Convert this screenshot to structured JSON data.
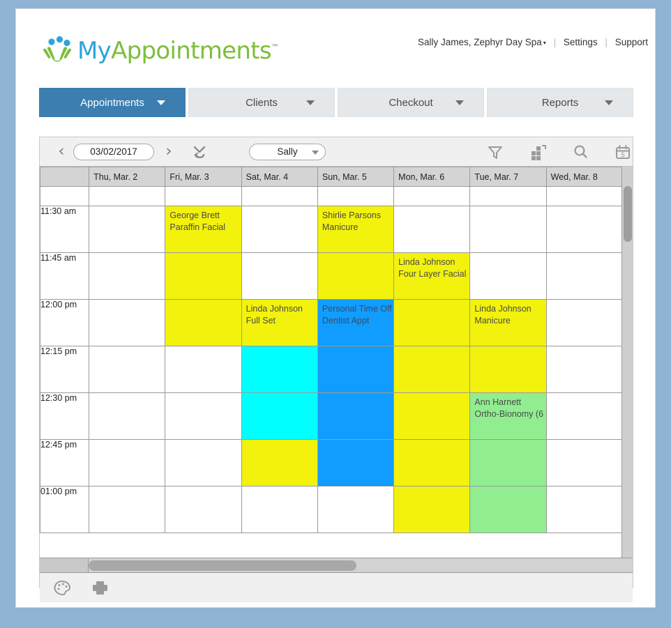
{
  "brand": {
    "name_part1": "My",
    "name_part2": "Appointments",
    "trademark": "™",
    "logo_icon": "hands-with-dots-logo",
    "color_blue": "#2EA3DC",
    "color_green": "#7DBE3B"
  },
  "account": {
    "user_and_org": "Sally James, Zephyr Day Spa",
    "caret": "▾",
    "separator": "|",
    "settings": "Settings",
    "support": "Support"
  },
  "nav": {
    "active_index": 0,
    "active_color": "#3C7EB0",
    "tabs": [
      {
        "label": "Appointments"
      },
      {
        "label": "Clients"
      },
      {
        "label": "Checkout"
      },
      {
        "label": "Reports"
      }
    ]
  },
  "toolbar": {
    "prev_arrow": "‹",
    "next_arrow": "›",
    "date": "03/02/2017",
    "collapse_icon": "collapse-rows-icon",
    "staff": {
      "value": "Sally"
    },
    "icons": [
      {
        "name": "filter-icon"
      },
      {
        "name": "grid-expand-icon"
      },
      {
        "name": "search-icon"
      },
      {
        "name": "calendar-day-icon",
        "badge": "5"
      }
    ]
  },
  "page_nav": {
    "prev": "‹",
    "next": "›"
  },
  "calendar": {
    "day_headers": [
      "Thu, Mar. 2",
      "Fri, Mar. 3",
      "Sat, Mar. 4",
      "Sun, Mar. 5",
      "Mon, Mar. 6",
      "Tue, Mar. 7",
      "Wed, Mar. 8"
    ],
    "times": [
      "11:30 am",
      "11:45 am",
      "12:00 pm",
      "12:15 pm",
      "12:30 pm",
      "12:45 pm",
      "01:00 pm"
    ],
    "colors": {
      "yellow": "#F2F20D",
      "cyan": "#00FFFF",
      "blue": "#119DFF",
      "green": "#90EE90",
      "header_gray": "#D4D4D4",
      "grid_line": "#9A9A9A"
    },
    "appointments": [
      {
        "day": 1,
        "time": 0,
        "client": "George Brett",
        "service": "Paraffin Facial",
        "color": "#F2F20D"
      },
      {
        "day": 3,
        "time": 0,
        "client": "Shirlie Parsons",
        "service": "Manicure",
        "color": "#F2F20D"
      },
      {
        "day": 1,
        "time": 1,
        "client": "",
        "service": "",
        "color": "#F2F20D"
      },
      {
        "day": 3,
        "time": 1,
        "client": "",
        "service": "",
        "color": "#F2F20D"
      },
      {
        "day": 4,
        "time": 1,
        "client": "Linda Johnson",
        "service": "Four Layer Facial",
        "color": "#F2F20D"
      },
      {
        "day": 1,
        "time": 2,
        "client": "",
        "service": "",
        "color": "#F2F20D"
      },
      {
        "day": 2,
        "time": 2,
        "client": "Linda Johnson",
        "service": "Full Set",
        "color": "#F2F20D"
      },
      {
        "day": 3,
        "time": 2,
        "client": "Personal Time Off",
        "service": "Dentist Appt",
        "color": "#119DFF"
      },
      {
        "day": 4,
        "time": 2,
        "client": "",
        "service": "",
        "color": "#F2F20D"
      },
      {
        "day": 5,
        "time": 2,
        "client": "Linda Johnson",
        "service": "Manicure",
        "color": "#F2F20D"
      },
      {
        "day": 2,
        "time": 3,
        "client": "",
        "service": "",
        "color": "#00FFFF"
      },
      {
        "day": 3,
        "time": 3,
        "client": "",
        "service": "",
        "color": "#119DFF"
      },
      {
        "day": 4,
        "time": 3,
        "client": "",
        "service": "",
        "color": "#F2F20D"
      },
      {
        "day": 5,
        "time": 3,
        "client": "",
        "service": "",
        "color": "#F2F20D"
      },
      {
        "day": 2,
        "time": 4,
        "client": "",
        "service": "",
        "color": "#00FFFF"
      },
      {
        "day": 3,
        "time": 4,
        "client": "",
        "service": "",
        "color": "#119DFF"
      },
      {
        "day": 4,
        "time": 4,
        "client": "",
        "service": "",
        "color": "#F2F20D"
      },
      {
        "day": 5,
        "time": 4,
        "client": "Ann Harnett",
        "service": "Ortho-Bionomy (6",
        "color": "#90EE90"
      },
      {
        "day": 2,
        "time": 5,
        "client": "",
        "service": "",
        "color": "#F2F20D"
      },
      {
        "day": 3,
        "time": 5,
        "client": "",
        "service": "",
        "color": "#119DFF"
      },
      {
        "day": 4,
        "time": 5,
        "client": "",
        "service": "",
        "color": "#F2F20D"
      },
      {
        "day": 5,
        "time": 5,
        "client": "",
        "service": "",
        "color": "#90EE90"
      },
      {
        "day": 4,
        "time": 6,
        "client": "",
        "service": "",
        "color": "#F2F20D"
      },
      {
        "day": 5,
        "time": 6,
        "client": "",
        "service": "",
        "color": "#90EE90"
      }
    ]
  },
  "footer": {
    "icons": [
      {
        "name": "color-palette-icon"
      },
      {
        "name": "printer-icon"
      }
    ]
  }
}
